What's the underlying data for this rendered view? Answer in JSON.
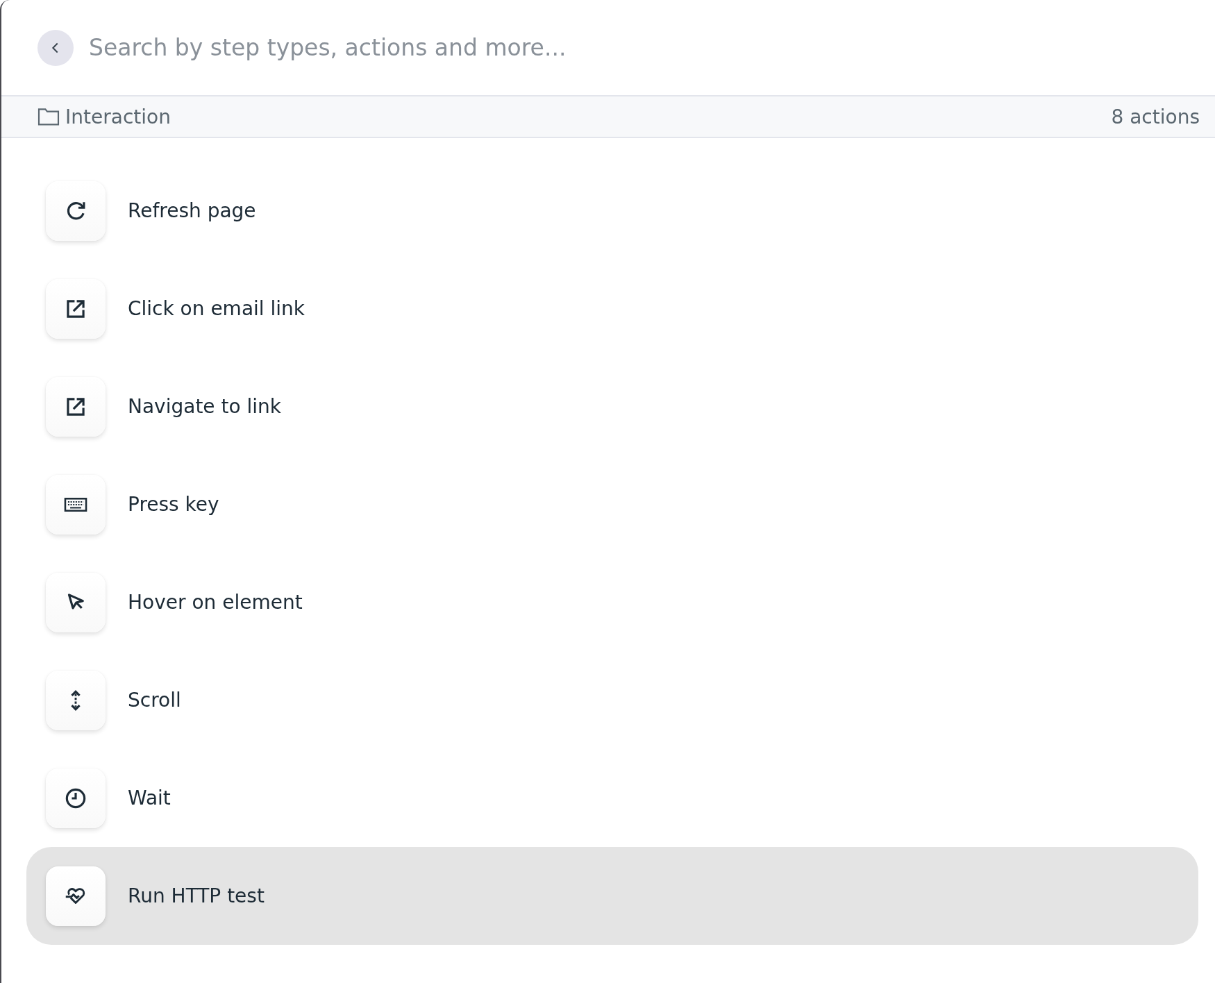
{
  "search": {
    "placeholder": "Search by step types, actions and more..."
  },
  "group": {
    "label": "Interaction",
    "count": "8 actions"
  },
  "actions": [
    {
      "kind": "refresh",
      "label": "Refresh page",
      "selected": false
    },
    {
      "kind": "external",
      "label": "Click on email link",
      "selected": false
    },
    {
      "kind": "external",
      "label": "Navigate to link",
      "selected": false
    },
    {
      "kind": "keyboard",
      "label": "Press key",
      "selected": false
    },
    {
      "kind": "pointer",
      "label": "Hover on element",
      "selected": false
    },
    {
      "kind": "scroll",
      "label": "Scroll",
      "selected": false
    },
    {
      "kind": "clock",
      "label": "Wait",
      "selected": false
    },
    {
      "kind": "heartbeat",
      "label": "Run HTTP test",
      "selected": true
    }
  ]
}
